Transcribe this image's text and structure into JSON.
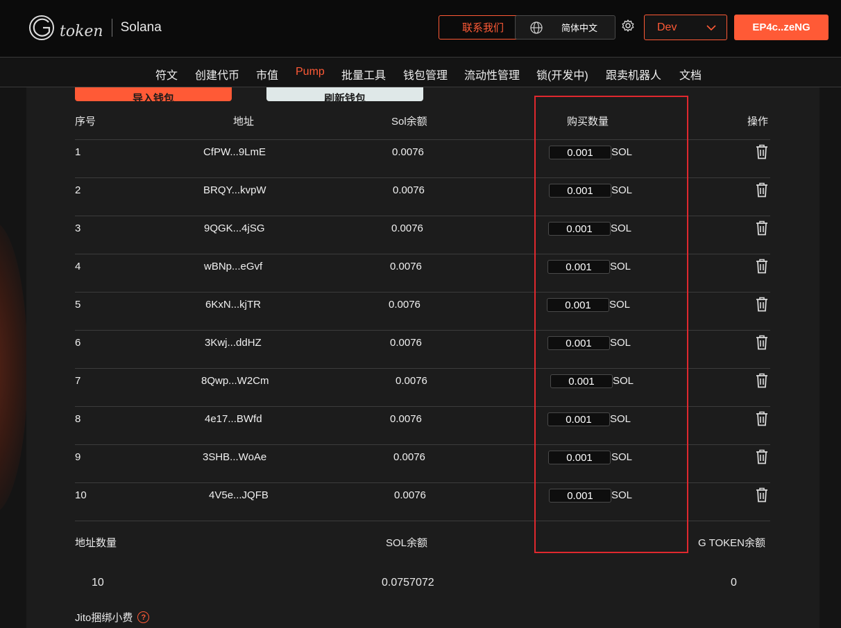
{
  "header": {
    "brand": "token",
    "chain": "Solana",
    "contact_label": "联系我们",
    "language_label": "简体中文",
    "network_label": "Dev",
    "wallet_label": "EP4c..zeNG",
    "accent_color": "#ff5a36"
  },
  "nav": {
    "items": [
      {
        "label": "符文",
        "active": false
      },
      {
        "label": "创建代币",
        "active": false
      },
      {
        "label": "市值",
        "active": false
      },
      {
        "label": "Pump",
        "active": true
      },
      {
        "label": "批量工具",
        "active": false
      },
      {
        "label": "钱包管理",
        "active": false
      },
      {
        "label": "流动性管理",
        "active": false
      },
      {
        "label": "锁(开发中)",
        "active": false
      },
      {
        "label": "跟卖机器人",
        "active": false
      },
      {
        "label": "文档",
        "active": false
      }
    ]
  },
  "actions": {
    "import_label": "导入钱包",
    "refresh_label": "刷新钱包"
  },
  "table": {
    "headers": {
      "index": "序号",
      "address": "地址",
      "balance": "Sol余额",
      "buy_amount": "购买数量",
      "operation": "操作"
    },
    "unit": "SOL",
    "rows": [
      {
        "index": "1",
        "address": "CfPW...9LmE",
        "balance": "0.0076",
        "amount": "0.001"
      },
      {
        "index": "2",
        "address": "BRQY...kvpW",
        "balance": "0.0076",
        "amount": "0.001"
      },
      {
        "index": "3",
        "address": "9QGK...4jSG",
        "balance": "0.0076",
        "amount": "0.001"
      },
      {
        "index": "4",
        "address": "wBNp...eGvf",
        "balance": "0.0076",
        "amount": "0.001"
      },
      {
        "index": "5",
        "address": "6KxN...kjTR",
        "balance": "0.0076",
        "amount": "0.001"
      },
      {
        "index": "6",
        "address": "3Kwj...ddHZ",
        "balance": "0.0076",
        "amount": "0.001"
      },
      {
        "index": "7",
        "address": "8Qwp...W2Cm",
        "balance": "0.0076",
        "amount": "0.001"
      },
      {
        "index": "8",
        "address": "4e17...BWfd",
        "balance": "0.0076",
        "amount": "0.001"
      },
      {
        "index": "9",
        "address": "3SHB...WoAe",
        "balance": "0.0076",
        "amount": "0.001"
      },
      {
        "index": "10",
        "address": "4V5e...JQFB",
        "balance": "0.0076",
        "amount": "0.001"
      }
    ]
  },
  "summary": {
    "address_count_label": "地址数量",
    "sol_balance_label": "SOL余额",
    "gtoken_balance_label": "G TOKEN余额",
    "address_count": "10",
    "sol_balance": "0.0757072",
    "gtoken_balance": "0"
  },
  "jito": {
    "label": "Jito捆绑小费",
    "help": "?"
  }
}
